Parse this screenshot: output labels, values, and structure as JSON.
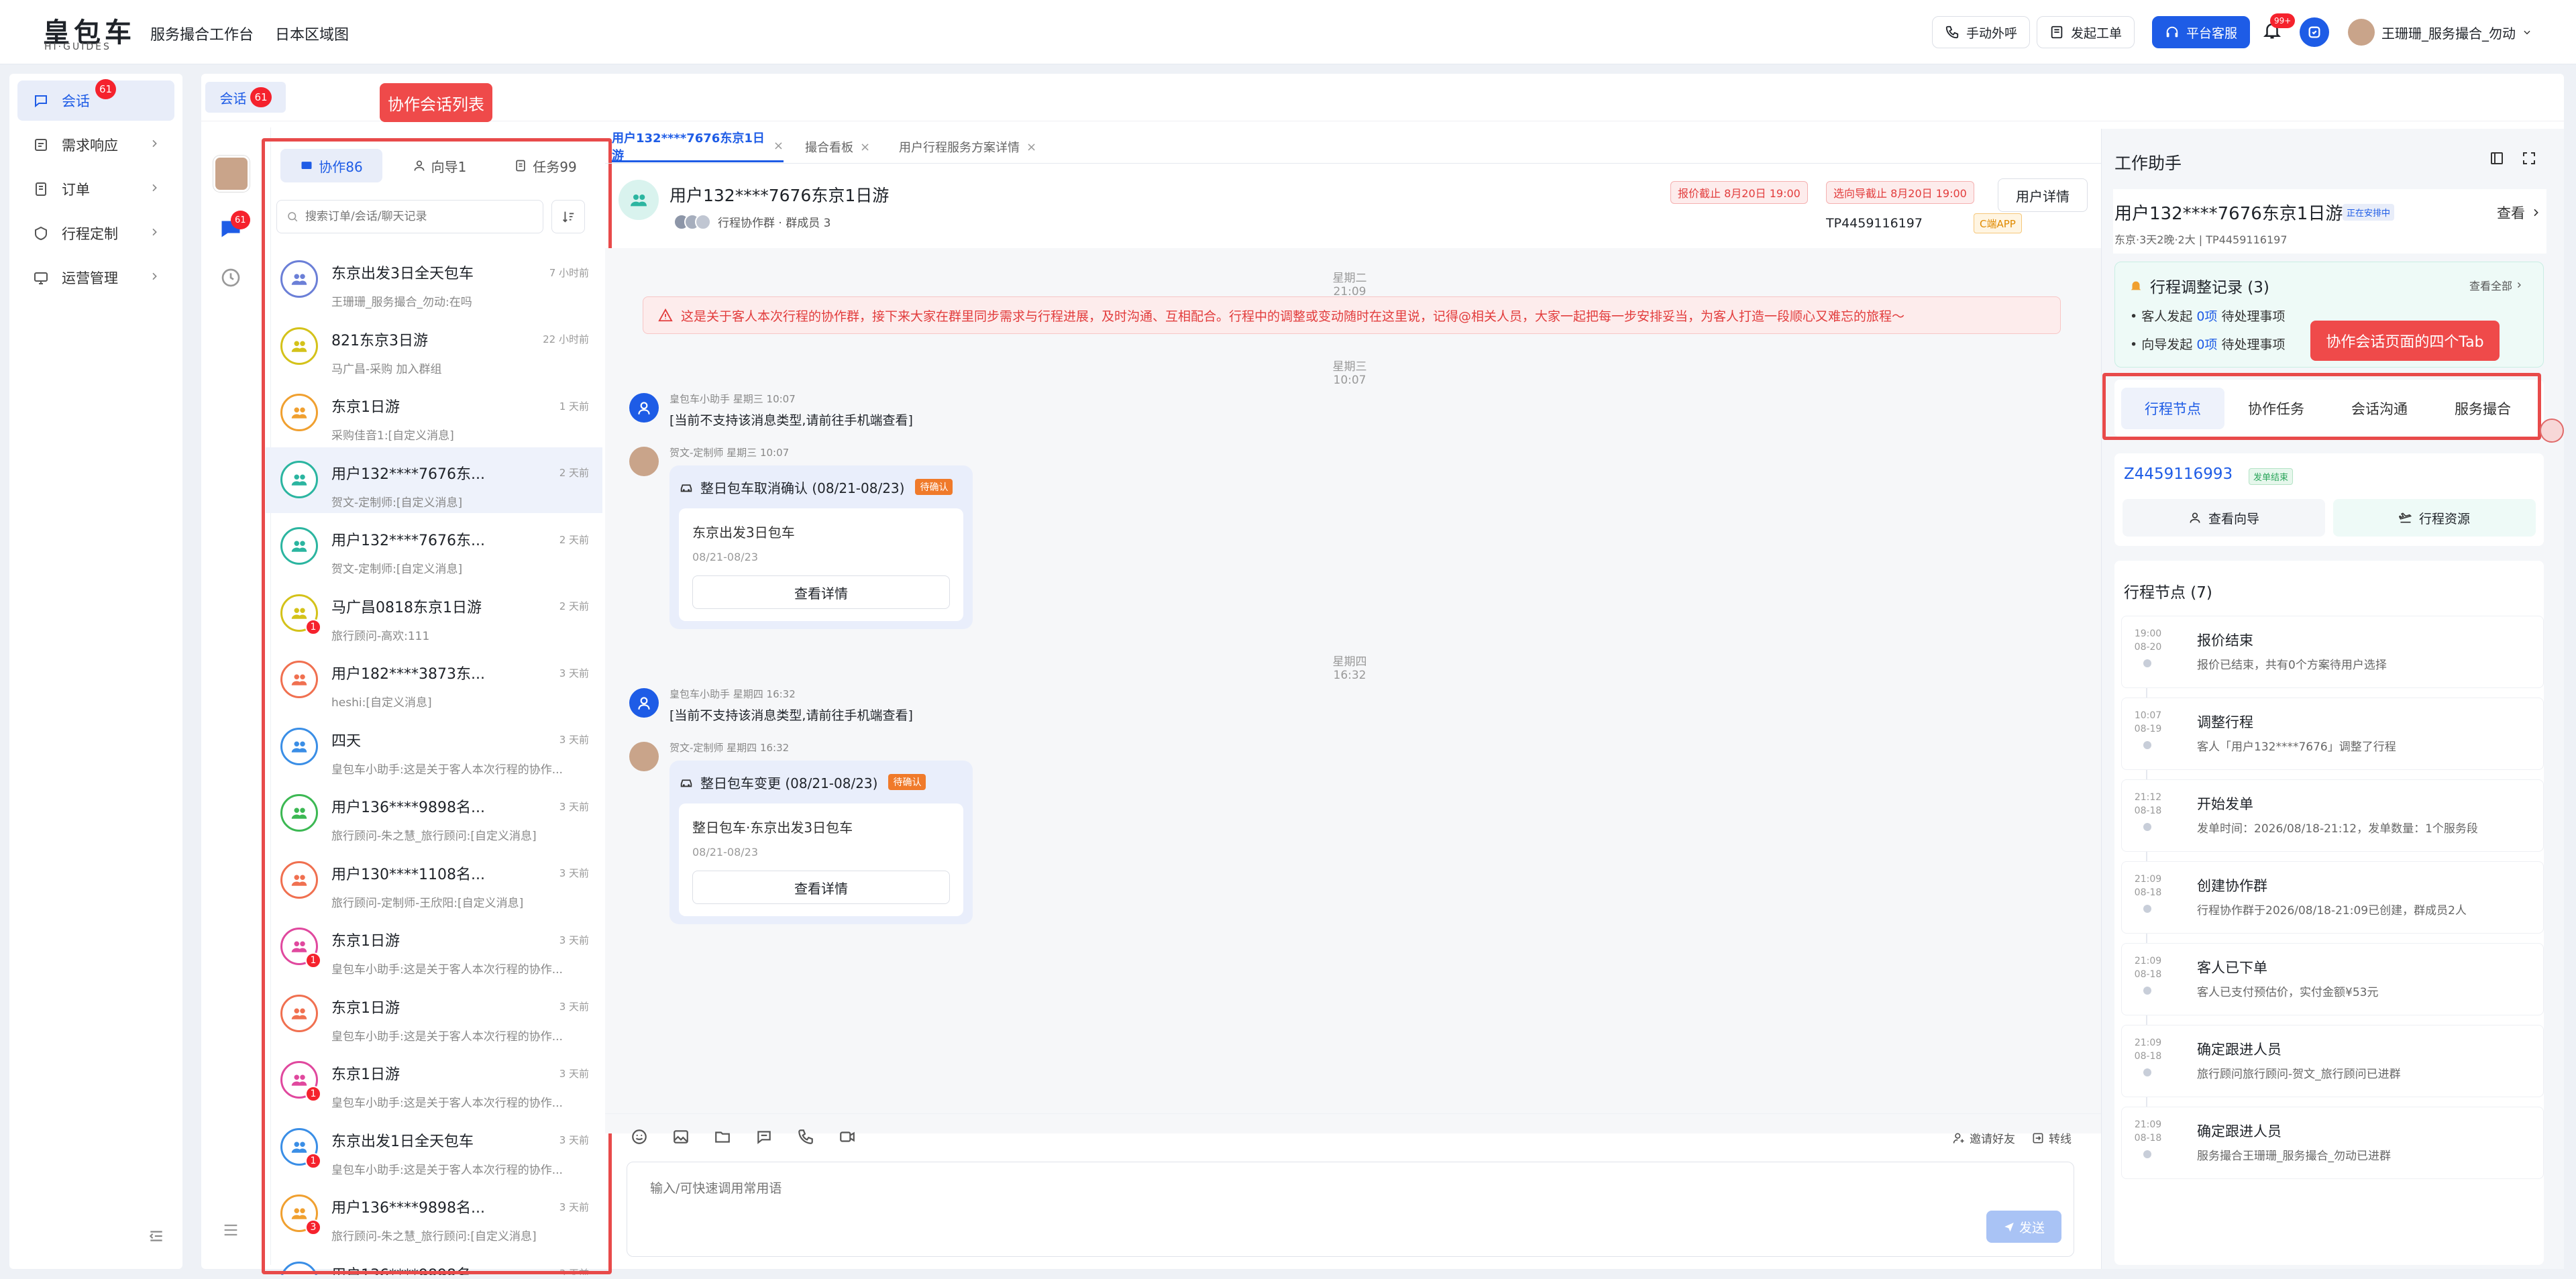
{
  "header": {
    "logo_cn": "皇包车",
    "logo_en": "HI·GUIDES",
    "nav": [
      "服务撮合工作台",
      "日本区域图"
    ],
    "manual_call": "手动外呼",
    "create_ticket": "发起工单",
    "platform_service": "平台客服",
    "notif_badge": "99+",
    "user": "王珊珊_服务撮合_勿动"
  },
  "sidebar": {
    "items": [
      {
        "label": "会话",
        "badge": "61",
        "icon": "chat-icon"
      },
      {
        "label": "需求响应",
        "icon": "request-icon"
      },
      {
        "label": "订单",
        "icon": "order-icon"
      },
      {
        "label": "行程定制",
        "icon": "itinerary-icon"
      },
      {
        "label": "运营管理",
        "icon": "operations-icon"
      }
    ]
  },
  "main_tab": {
    "label": "会话",
    "badge": "61"
  },
  "annotations": {
    "list_label": "协作会话列表",
    "tabs_label": "协作会话页面的四个Tab"
  },
  "left_rail": {
    "badge": "61"
  },
  "conv_list": {
    "tabs": [
      {
        "label": "协作86",
        "icon": "collab-icon"
      },
      {
        "label": "向导1",
        "icon": "guide-icon"
      },
      {
        "label": "任务99",
        "icon": "task-icon"
      }
    ],
    "search_placeholder": "搜索订单/会话/聊天记录",
    "items": [
      {
        "name": "东京出发3日全天包车",
        "time": "7 小时前",
        "preview": "王珊珊_服务撮合_勿动:在吗",
        "color": "#6b7fd7",
        "badge": ""
      },
      {
        "name": "821东京3日游",
        "time": "22 小时前",
        "preview": "马广昌-采购 加入群组",
        "color": "#d4c21a",
        "badge": ""
      },
      {
        "name": "东京1日游",
        "time": "1 天前",
        "preview": "采购佳音1:[自定义消息]",
        "color": "#f0a030",
        "badge": ""
      },
      {
        "name": "用户132****7676东...",
        "time": "2 天前",
        "preview": "贺文-定制师:[自定义消息]",
        "color": "#2bb5a0",
        "badge": ""
      },
      {
        "name": "用户132****7676东...",
        "time": "2 天前",
        "preview": "贺文-定制师:[自定义消息]",
        "color": "#2bb5a0",
        "badge": ""
      },
      {
        "name": "马广昌0818东京1日游",
        "time": "2 天前",
        "preview": "旅行顾问-高欢:111",
        "color": "#d4c21a",
        "badge": "1"
      },
      {
        "name": "用户182****3873东...",
        "time": "3 天前",
        "preview": "heshi:[自定义消息]",
        "color": "#f07050",
        "badge": ""
      },
      {
        "name": "四天",
        "time": "3 天前",
        "preview": "皇包车小助手:这是关于客人本次行程的协作...",
        "color": "#3a8ee6",
        "badge": ""
      },
      {
        "name": "用户136****9898名...",
        "time": "3 天前",
        "preview": "旅行顾问-朱之慧_旅行顾问:[自定义消息]",
        "color": "#3cb853",
        "badge": ""
      },
      {
        "name": "用户130****1108名...",
        "time": "3 天前",
        "preview": "旅行顾问-定制师-王欣阳:[自定义消息]",
        "color": "#f07050",
        "badge": ""
      },
      {
        "name": "东京1日游",
        "time": "3 天前",
        "preview": "皇包车小助手:这是关于客人本次行程的协作...",
        "color": "#e0489e",
        "badge": "1"
      },
      {
        "name": "东京1日游",
        "time": "3 天前",
        "preview": "皇包车小助手:这是关于客人本次行程的协作...",
        "color": "#f07050",
        "badge": ""
      },
      {
        "name": "东京1日游",
        "time": "3 天前",
        "preview": "皇包车小助手:这是关于客人本次行程的协作...",
        "color": "#e0489e",
        "badge": "1"
      },
      {
        "name": "东京出发1日全天包车",
        "time": "3 天前",
        "preview": "皇包车小助手:这是关于客人本次行程的协作...",
        "color": "#3a8ee6",
        "badge": "1"
      },
      {
        "name": "用户136****9898名...",
        "time": "3 天前",
        "preview": "旅行顾问-朱之慧_旅行顾问:[自定义消息]",
        "color": "#f0a030",
        "badge": "3"
      },
      {
        "name": "用户136****9898名...",
        "time": "3 天前",
        "preview": "",
        "color": "#3a8ee6",
        "badge": ""
      }
    ]
  },
  "chat_tabs": [
    {
      "label": "用户132****7676东京1日游",
      "active": true
    },
    {
      "label": "撮合看板",
      "active": false
    },
    {
      "label": "用户行程服务方案详情",
      "active": false
    }
  ],
  "chat": {
    "title": "用户132****7676东京1日游",
    "group_info": "行程协作群 · 群成员 3",
    "quote_deadline": "报价截止 8月20日 19:00",
    "guide_deadline": "选向导截止 8月20日 19:00",
    "user_detail_button": "用户详情",
    "tp_number": "TP4459116197",
    "app_tag": "C端APP",
    "day1": "星期二 21:09",
    "notice": "这是关于客人本次行程的协作群，接下来大家在群里同步需求与行程进展，及时沟通、互相配合。行程中的调整或变动随时在这里说，记得@相关人员，大家一起把每一步安排妥当，为客人打造一段顺心又难忘的旅程～",
    "day2": "星期三 10:07",
    "msg1_sender": "皇包车小助手 星期三 10:07",
    "msg1_text": "[当前不支持该消息类型,请前往手机端查看]",
    "msg2_sender": "贺文-定制师 星期三 10:07",
    "card1": {
      "title": "整日包车取消确认 (08/21-08/23)",
      "status": "待确认",
      "subtitle": "东京出发3日包车",
      "date": "08/21-08/23",
      "button": "查看详情"
    },
    "day3": "星期四 16:32",
    "msg3_sender": "皇包车小助手 星期四 16:32",
    "msg3_text": "[当前不支持该消息类型,请前往手机端查看]",
    "msg4_sender": "贺文-定制师 星期四 16:32",
    "card2": {
      "title": "整日包车变更 (08/21-08/23)",
      "status": "待确认",
      "subtitle": "整日包车·东京出发3日包车",
      "date": "08/21-08/23",
      "button": "查看详情"
    },
    "invite_friend": "邀请好友",
    "transfer": "转线",
    "input_placeholder": "输入/可快速调用常用语",
    "send_button": "发送"
  },
  "assistant": {
    "title": "工作助手",
    "trip_title": "用户132****7676东京1日游",
    "trip_status": "正在安排中",
    "view_button": "查看",
    "trip_meta": "东京·3天2晚·2大 | TP4459116197",
    "adjust_title": "行程调整记录 (3)",
    "view_all": "查看全部",
    "adjust_items": [
      {
        "prefix": "客人发起",
        "count": "0项",
        "suffix": "待处理事项"
      },
      {
        "prefix": "向导发起",
        "count": "0项",
        "suffix": "待处理事项"
      }
    ],
    "tabs": [
      "行程节点",
      "协作任务",
      "会话沟通",
      "服务撮合"
    ],
    "order_no": "Z4459116993",
    "order_status": "发单结束",
    "view_guide": "查看向导",
    "trip_resource": "行程资源",
    "nodes_title": "行程节点 (7)",
    "nodes": [
      {
        "time": "19:00",
        "date": "08-20",
        "title": "报价结束",
        "desc": "报价已结束，共有0个方案待用户选择"
      },
      {
        "time": "10:07",
        "date": "08-19",
        "title": "调整行程",
        "desc": "客人「用户132****7676」调整了行程"
      },
      {
        "time": "21:12",
        "date": "08-18",
        "title": "开始发单",
        "desc": "发单时间：2026/08/18-21:12，发单数量：1个服务段"
      },
      {
        "time": "21:09",
        "date": "08-18",
        "title": "创建协作群",
        "desc": "行程协作群于2026/08/18-21:09已创建，群成员2人"
      },
      {
        "time": "21:09",
        "date": "08-18",
        "title": "客人已下单",
        "desc": "客人已支付预估价，实付金额¥53元"
      },
      {
        "time": "21:09",
        "date": "08-18",
        "title": "确定跟进人员",
        "desc": "旅行顾问旅行顾问-贺文_旅行顾问已进群"
      },
      {
        "time": "21:09",
        "date": "08-18",
        "title": "确定跟进人员",
        "desc": "服务撮合王珊珊_服务撮合_勿动已进群"
      }
    ]
  },
  "colors": {
    "primary": "#1e5ce6",
    "accent_red": "#ef4a4a",
    "bg": "#eef1f6"
  }
}
